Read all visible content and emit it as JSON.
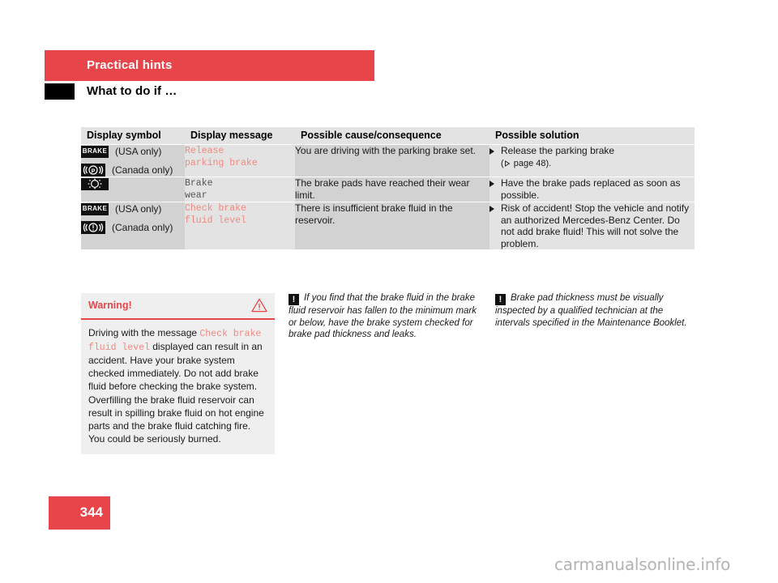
{
  "header": {
    "chapter": "Practical hints",
    "section": "What to do if …"
  },
  "table": {
    "columns": [
      "Display symbol",
      "Display message",
      "Possible cause/consequence",
      "Possible solution"
    ],
    "rows": [
      {
        "symbols": [
          {
            "icon": "brake-text-icon",
            "glyph": "BRAKE",
            "label": "(USA only)"
          },
          {
            "icon": "parking-brake-p-icon",
            "glyph": "((P))",
            "label": "(Canada only)"
          }
        ],
        "message": "Release\nparking brake",
        "message_color": "#f08a80",
        "cause": "You are driving with the parking brake set.",
        "solution": "Release the parking brake",
        "solution_ref": "( page 48).",
        "solution_ref_page": "page 48"
      },
      {
        "symbols": [
          {
            "icon": "brake-wear-disc-icon",
            "glyph": "{O}",
            "label": ""
          }
        ],
        "message": "Brake\nwear",
        "message_color": "#555555",
        "cause": "The brake pads have reached their wear limit.",
        "solution": "Have the brake pads replaced as soon as possible.",
        "solution_ref": "",
        "solution_ref_page": ""
      },
      {
        "symbols": [
          {
            "icon": "brake-text-icon",
            "glyph": "BRAKE",
            "label": "(USA only)"
          },
          {
            "icon": "brake-warning-exclamation-icon",
            "glyph": "((!))",
            "label": "(Canada only)"
          }
        ],
        "message": "Check brake\nfluid level",
        "message_color": "#f08a80",
        "cause": "There is insufficient brake fluid in the reservoir.",
        "solution": "Risk of accident! Stop the vehicle and notify an authorized Mercedes-Benz Center. Do not add brake fluid! This will not solve the problem.",
        "solution_ref": "",
        "solution_ref_page": ""
      }
    ]
  },
  "warning": {
    "title": "Warning!",
    "icon": "warning-triangle-icon",
    "text_before": "Driving with the message ",
    "mono_text": "Check brake fluid level",
    "text_after": " displayed can result in an accident. Have your brake system checked immediately. Do not add brake fluid before checking the brake system. Overfilling the brake fluid reservoir can result in spilling brake fluid on hot engine parts and the brake fluid catching fire. You could be seriously burned."
  },
  "notes": [
    {
      "icon": "note-exclamation-icon",
      "marker": "!",
      "text": "If you find that the brake fluid in the brake fluid reservoir has fallen to the minimum mark or below, have the brake system checked for brake pad thickness and leaks."
    },
    {
      "icon": "note-exclamation-icon",
      "marker": "!",
      "text": "Brake pad thickness must be visually inspected by a qualified technician at the intervals specified in the Maintenance Booklet."
    }
  ],
  "footer": {
    "page_number": "344",
    "watermark": "carmanualsonline.info"
  },
  "colors": {
    "accent_red": "#e8454a",
    "mono_red": "#f08a80",
    "shade_dark": "#d2d2d2",
    "shade_light": "#e3e3e3",
    "header_shade": "#e3e3e3"
  }
}
